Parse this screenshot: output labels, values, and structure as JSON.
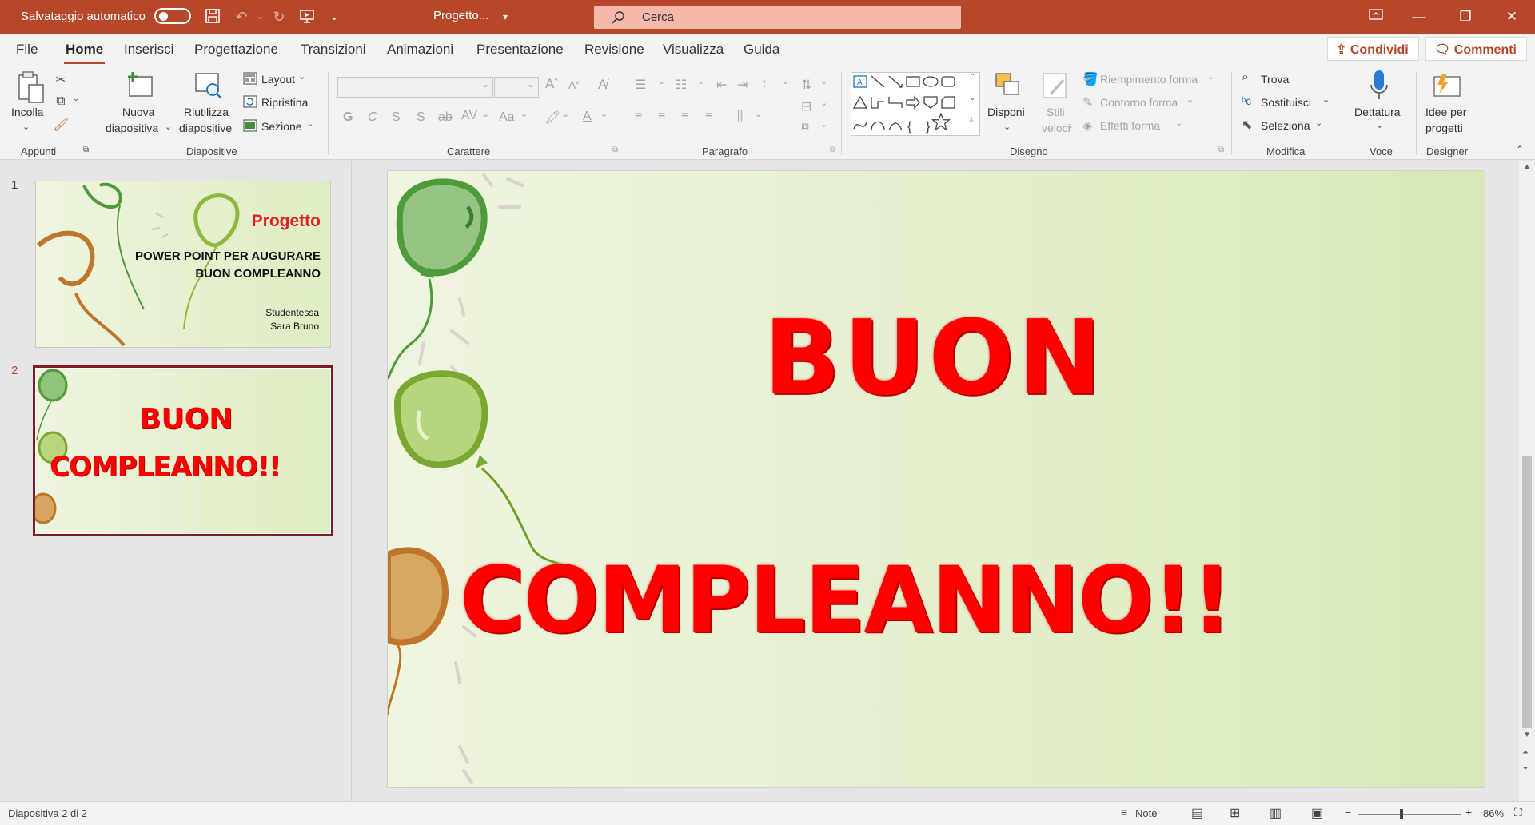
{
  "titlebar": {
    "autosave_label": "Salvataggio automatico",
    "doc_title": "Progetto...",
    "search_placeholder": "Cerca"
  },
  "menu": {
    "tabs": [
      "File",
      "Home",
      "Inserisci",
      "Progettazione",
      "Transizioni",
      "Animazioni",
      "Presentazione",
      "Revisione",
      "Visualizza",
      "Guida"
    ],
    "active": "Home",
    "share": "Condividi",
    "comments": "Commenti"
  },
  "ribbon": {
    "appunti": {
      "paste": "Incolla",
      "group": "Appunti"
    },
    "diapositive": {
      "new_slide_1": "Nuova",
      "new_slide_2": "diapositiva",
      "reuse_1": "Riutilizza",
      "reuse_2": "diapositive",
      "layout": "Layout",
      "reset": "Ripristina",
      "section": "Sezione",
      "group": "Diapositive"
    },
    "carattere": {
      "bold": "G",
      "italic": "C",
      "underline": "S",
      "shadow": "S",
      "strike": "ab",
      "spacing": "AV",
      "case": "Aa",
      "group": "Carattere"
    },
    "paragrafo": {
      "group": "Paragrafo"
    },
    "disegno": {
      "arrange": "Disponi",
      "quick_styles_1": "Stili",
      "quick_styles_2": "veloci",
      "fill": "Riempimento forma",
      "outline": "Contorno forma",
      "effects": "Effetti forma",
      "group": "Disegno"
    },
    "modifica": {
      "find": "Trova",
      "replace": "Sostituisci",
      "select": "Seleziona",
      "group": "Modifica"
    },
    "voce": {
      "dictate": "Dettatura",
      "group": "Voce"
    },
    "designer": {
      "ideas_1": "Idee per",
      "ideas_2": "progetti",
      "group": "Designer"
    }
  },
  "slides": [
    {
      "number": "1",
      "title": "Progetto",
      "subtitle_1": "POWER POINT PER AUGURARE",
      "subtitle_2": "BUON COMPLEANNO",
      "author_1": "Studentessa",
      "author_2": "Sara Bruno"
    },
    {
      "number": "2",
      "line1": "BUON",
      "line2": "COMPLEANNO!!"
    }
  ],
  "main_slide": {
    "line1": "BUON",
    "line2": "COMPLEANNO!!"
  },
  "statusbar": {
    "slide_info": "Diapositiva 2 di 2",
    "notes": "Note",
    "zoom": "86%",
    "zoom_level": 0.86
  },
  "colors": {
    "accent": "#b7472a",
    "wordart": "#ff0000",
    "slide_bg": "#e3efcb",
    "selected_thumb": "#7a1f27"
  }
}
